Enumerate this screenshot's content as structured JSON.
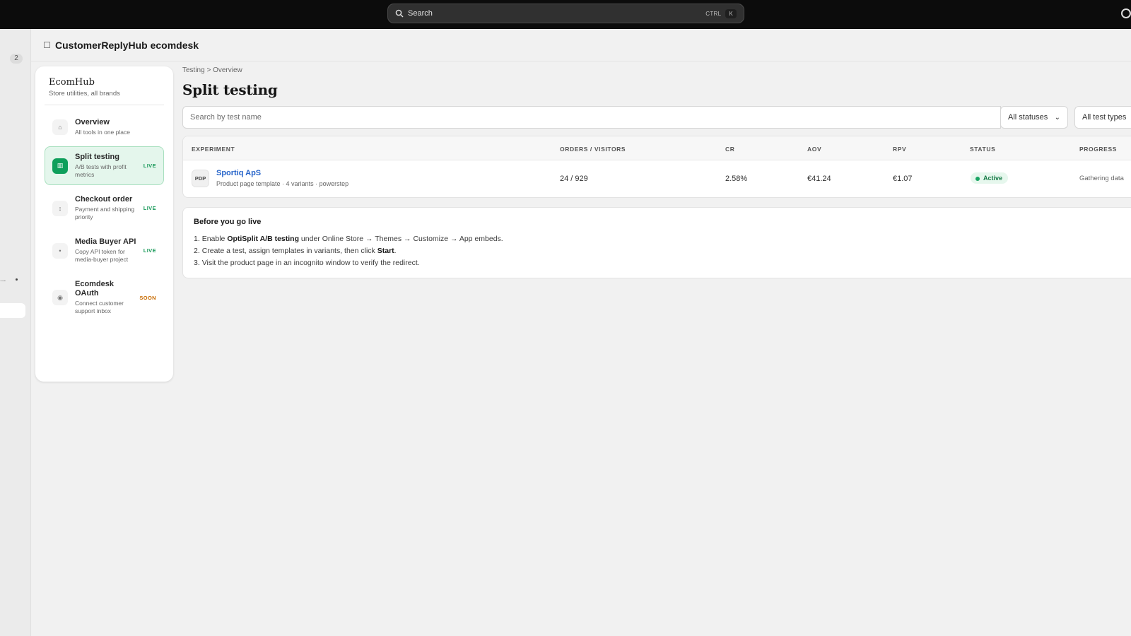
{
  "topbar": {
    "search_placeholder": "Search",
    "shortcut_modifier": "CTRL",
    "shortcut_key": "K"
  },
  "rail": {
    "badge_count": "2",
    "truncated": "..."
  },
  "app": {
    "title": "CustomerReplyHub ecomdesk"
  },
  "sidebar": {
    "brand": "EcomHub",
    "subtitle": "Store utilities, all brands",
    "items": [
      {
        "title": "Overview",
        "desc": "All tools in one place",
        "tag": "",
        "icon": "home-icon",
        "active": false
      },
      {
        "title": "Split testing",
        "desc": "A/B tests with profit metrics",
        "tag": "LIVE",
        "icon": "split-icon",
        "active": true
      },
      {
        "title": "Checkout order",
        "desc": "Payment and shipping priority",
        "tag": "LIVE",
        "icon": "sort-icon",
        "active": false
      },
      {
        "title": "Media Buyer API",
        "desc": "Copy API token for media-buyer project",
        "tag": "LIVE",
        "icon": "key-icon",
        "active": false
      },
      {
        "title": "Ecomdesk OAuth",
        "desc": "Connect customer support inbox",
        "tag": "SOON",
        "icon": "link-icon",
        "active": false
      }
    ]
  },
  "main": {
    "breadcrumb": "Testing > Overview",
    "title": "Split testing",
    "search_placeholder": "Search by test name",
    "status_filter": "All statuses",
    "type_filter": "All test types",
    "table": {
      "headers": {
        "experiment": "EXPERIMENT",
        "orders_visitors": "ORDERS / VISITORS",
        "cr": "CR",
        "aov": "AOV",
        "rpv": "RPV",
        "status": "STATUS",
        "progress": "PROGRESS"
      },
      "rows": [
        {
          "type_badge": "PDP",
          "name": "Sportiq ApS",
          "meta": "Product page template · 4 variants · powerstep",
          "orders_visitors": "24 / 929",
          "cr": "2.58%",
          "aov": "€41.24",
          "rpv": "€1.07",
          "status": "Active",
          "progress": "Gathering data"
        }
      ]
    },
    "golive": {
      "title": "Before you go live",
      "step1_pre": "Enable ",
      "step1_bold": "OptiSplit A/B testing",
      "step1_post": " under Online Store → Themes → Customize → App embeds.",
      "step2_pre": "Create a test, assign templates in variants, then click ",
      "step2_bold": "Start",
      "step2_post": ".",
      "step3": "Visit the product page in an incognito window to verify the redirect."
    }
  },
  "colors": {
    "accent_green": "#0e9f5b",
    "link_blue": "#2563c9",
    "soon_orange": "#c86b00"
  }
}
